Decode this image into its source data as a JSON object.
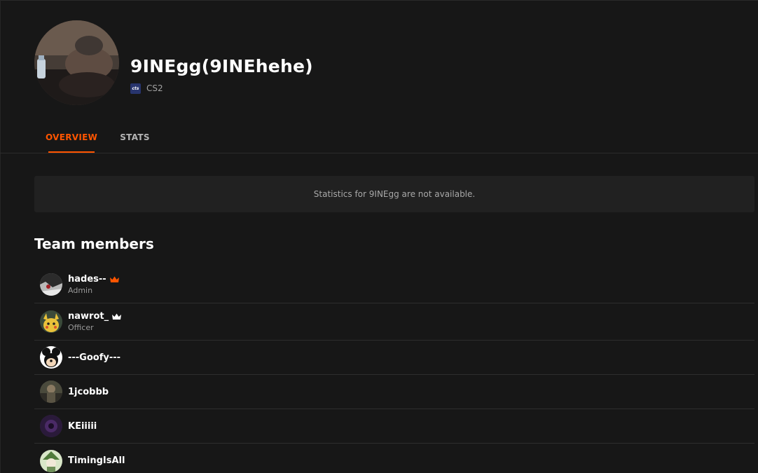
{
  "team": {
    "name": "9INEgg(9INEhehe)",
    "game_icon_text": "cts",
    "game": "CS2",
    "avatar_icon": "dog-photo-avatar"
  },
  "tabs": [
    {
      "label": "OVERVIEW",
      "active": true
    },
    {
      "label": "STATS",
      "active": false
    }
  ],
  "stats_notice": "Statistics for 9INEgg are not available.",
  "members_section": {
    "title": "Team members",
    "members": [
      {
        "name": "hades--",
        "role": "Admin",
        "crown": "orange-crown-icon"
      },
      {
        "name": "nawrot_",
        "role": "Officer",
        "crown": "white-crown-icon"
      },
      {
        "name": "---Goofy---"
      },
      {
        "name": "1jcobbb"
      },
      {
        "name": "KEiiiii"
      },
      {
        "name": "TimingIsAll"
      }
    ]
  },
  "colors": {
    "accent": "#ff5500",
    "background": "#171717",
    "panel": "#212121"
  }
}
